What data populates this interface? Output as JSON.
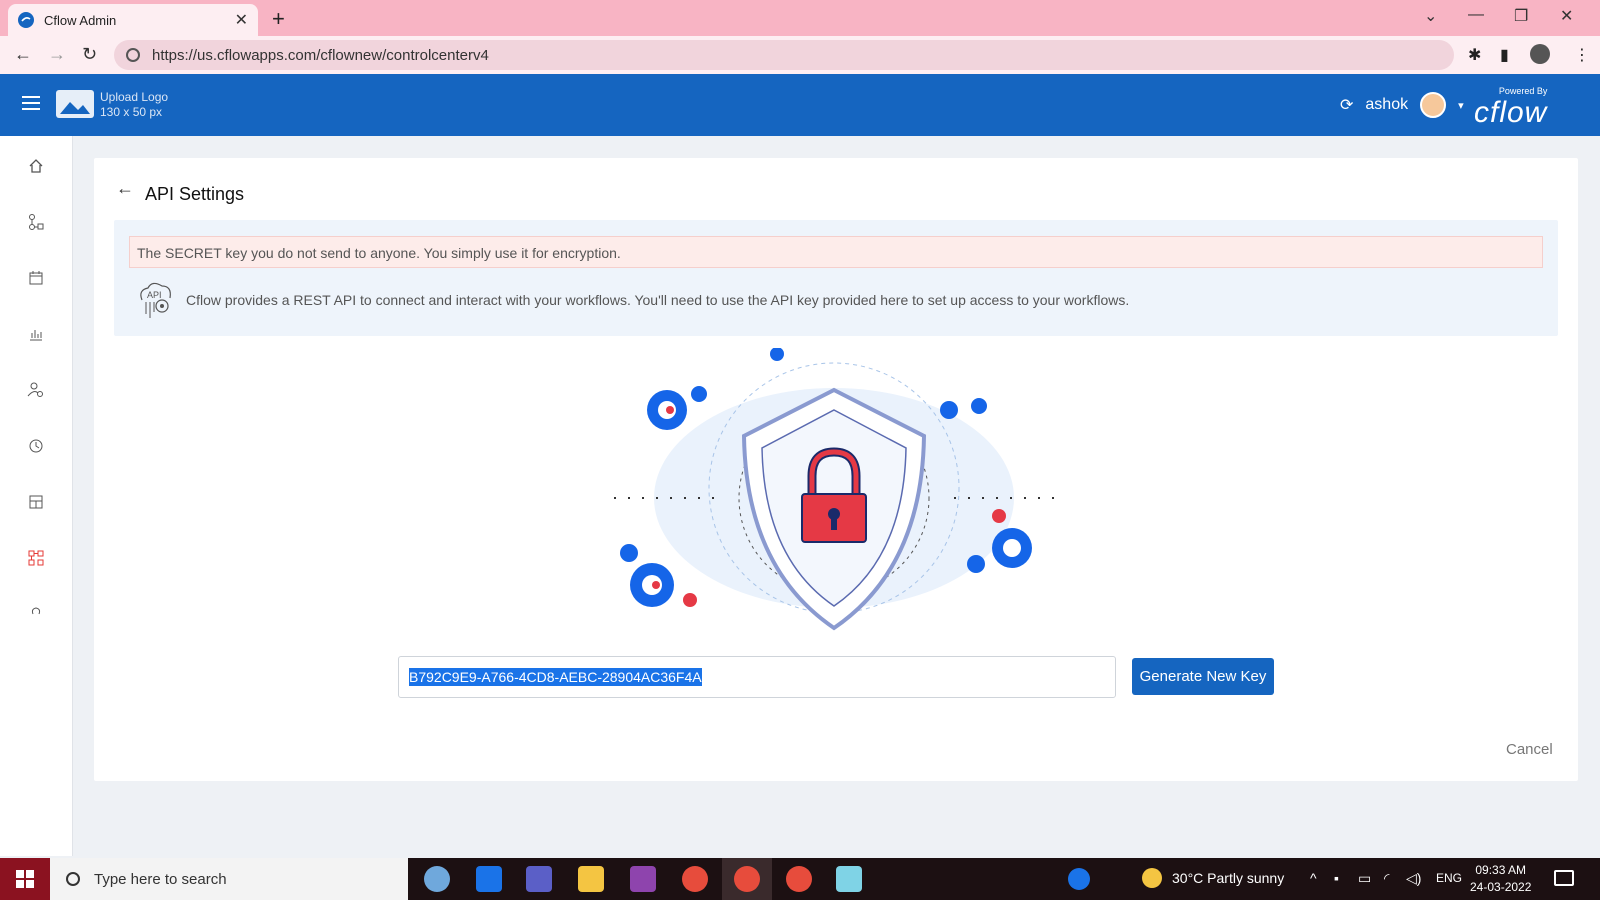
{
  "browser": {
    "tab_title": "Cflow Admin",
    "tab_close": "✕",
    "new_tab": "+",
    "url": "https://us.cflowapps.com/cflownew/controlcenterv4"
  },
  "header": {
    "upload_logo_line1": "Upload Logo",
    "upload_logo_line2": "130 x 50 px",
    "username": "ashok",
    "powered_by": "Powered By",
    "brand": "cflow",
    "colors": {
      "header_bg": "#1565c0",
      "accent": "#1565c0"
    }
  },
  "sidebar": {
    "items": [
      {
        "icon": "home-icon"
      },
      {
        "icon": "workflow-icon"
      },
      {
        "icon": "calendar-icon"
      },
      {
        "icon": "reports-icon"
      },
      {
        "icon": "user-settings-icon"
      },
      {
        "icon": "history-icon"
      },
      {
        "icon": "dashboard-icon"
      },
      {
        "icon": "api-settings-icon",
        "active": true
      },
      {
        "icon": "help-icon"
      }
    ]
  },
  "main": {
    "page_title": "API Settings",
    "secret_notice": "The SECRET key you do not send to anyone. You simply use it for encryption.",
    "info_text": "Cflow provides a REST API to connect and interact with your workflows. You'll need to use the API key provided here to set up access to your workflows.",
    "api_key": "B792C9E9-A766-4CD8-AEBC-28904AC36F4A",
    "generate_button": "Generate New Key",
    "cancel_button": "Cancel"
  },
  "taskbar": {
    "search_placeholder": "Type here to search",
    "weather": "30°C  Partly sunny",
    "language": "ENG",
    "time": "09:33 AM",
    "date": "24-03-2022"
  }
}
